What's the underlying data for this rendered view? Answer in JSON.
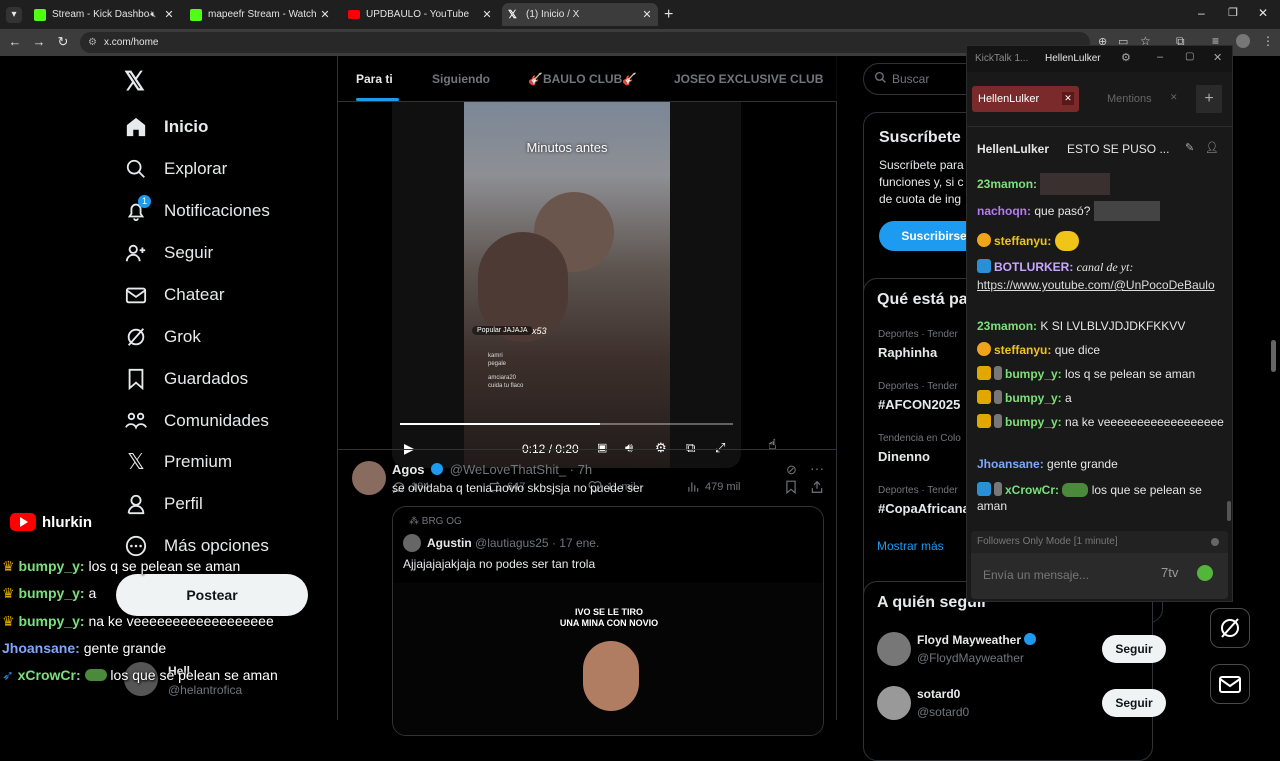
{
  "browser": {
    "tabs": [
      {
        "title": "Stream - Kick Dashboard",
        "favicon_color": "#53fc18",
        "extra": "mute-icon"
      },
      {
        "title": "mapeefr Stream - Watch Live o",
        "favicon_color": "#53fc18"
      },
      {
        "title": "UPDBAULO - YouTube",
        "favicon_color": "#ff0000"
      },
      {
        "title": "(1) Inicio / X",
        "favicon_color": "#ffffff"
      }
    ],
    "url": "x.com/home"
  },
  "nav": {
    "items": [
      {
        "label": "Inicio",
        "icon": "home-icon"
      },
      {
        "label": "Explorar",
        "icon": "search-icon"
      },
      {
        "label": "Notificaciones",
        "icon": "bell-icon",
        "badge": "1"
      },
      {
        "label": "Seguir",
        "icon": "follow-icon"
      },
      {
        "label": "Chatear",
        "icon": "mail-icon"
      },
      {
        "label": "Grok",
        "icon": "grok-icon"
      },
      {
        "label": "Guardados",
        "icon": "bookmark-icon"
      },
      {
        "label": "Comunidades",
        "icon": "communities-icon"
      },
      {
        "label": "Premium",
        "icon": "x-logo-icon"
      },
      {
        "label": "Perfil",
        "icon": "person-icon"
      },
      {
        "label": "Más opciones",
        "icon": "more-icon"
      }
    ],
    "post_button": "Postear",
    "account": {
      "name": "Hell",
      "handle": "@helantrofica"
    }
  },
  "timeline": {
    "tabs": [
      "Para ti",
      "Siguiendo",
      "🎸BAULO CLUB🎸",
      "JOSEO EXCLUSIVE CLUB"
    ],
    "video": {
      "caption": "Minutos antes",
      "time": "0:12 / 0:20",
      "progress": 0.6,
      "overlay_tag": "Popular JAJAJA",
      "overlay_count": "x53",
      "comments": [
        {
          "user": "kamri",
          "text": "pegale"
        },
        {
          "user": "amciara20",
          "text": "cuida tu flaco"
        }
      ]
    },
    "tweet1_actions": {
      "replies": "184",
      "reposts": "647",
      "likes": "11 mil",
      "views": "479 mil"
    },
    "tweet2": {
      "name": "Agos",
      "handle": "@WeLoveThatShit_",
      "time": "· 7h",
      "text": "se olvidaba q tenia novio skbsjsja no puede ser",
      "quote": {
        "community": "BRG OG",
        "name": "Agustin",
        "handle": "@lautiagus25",
        "time": "· 17 ene.",
        "text": "Ajjajajajakjaja no podes ser tan trola",
        "media_caption": "IVO SE LE TIRO\nUNA MINA CON NOVIO"
      }
    }
  },
  "sidebar": {
    "search_placeholder": "Buscar",
    "subscribe": {
      "title": "Suscríbete",
      "body1": "Suscríbete para",
      "body2": "funciones y, si c",
      "body3": "de cuota de ing",
      "button": "Suscribirse"
    },
    "trends": {
      "title": "Qué está pa",
      "items": [
        {
          "meta": "Deportes · Tender",
          "name": "Raphinha"
        },
        {
          "meta": "Deportes · Tender",
          "name": "#AFCON2025"
        },
        {
          "meta": "Tendencia en Colo",
          "name": "Dinenno"
        },
        {
          "meta": "Deportes · Tender",
          "name": "#CopaAfricana"
        }
      ],
      "show_more": "Mostrar más"
    },
    "who_to_follow": {
      "title": "A quién seguir",
      "items": [
        {
          "name": "Floyd Mayweather",
          "handle": "@FloydMayweather",
          "verified": true,
          "button": "Seguir"
        },
        {
          "name": "sotard0",
          "handle": "@sotard0",
          "verified": false,
          "button": "Seguir"
        }
      ]
    }
  },
  "kicktalk": {
    "app_title": "KickTalk 1...",
    "user": "HellenLulker",
    "tabs": [
      {
        "label": "HellenLulker"
      },
      {
        "label": "Mentions"
      }
    ],
    "stream_header_user": "HellenLulker",
    "stream_header_title": "ESTO SE PUSO ...",
    "messages": [
      {
        "user": "23mamon:",
        "text": "",
        "color": "#7be07b"
      },
      {
        "user": "nachoqn:",
        "text": "que pasó?",
        "color": "#b57cf0"
      },
      {
        "user": "steffanyu:",
        "text": "",
        "color": "#f0c419"
      },
      {
        "user": "BOTLURKER:",
        "text": "canal de yt:",
        "link": "https://www.youtube.com/@UnPocoDeBaulo",
        "color": "#c9a6ff"
      },
      {
        "user": "23mamon:",
        "text": "K SI LVLBLVJDJDKFKKVV",
        "color": "#7be07b"
      },
      {
        "user": "steffanyu:",
        "text": "que dice",
        "color": "#f0c419"
      },
      {
        "user": "bumpy_y:",
        "text": "los q se pelean se aman",
        "color": "#7be07b"
      },
      {
        "user": "bumpy_y:",
        "text": "a",
        "color": "#7be07b"
      },
      {
        "user": "bumpy_y:",
        "text": "na ke veeeeeeeeeeeeeeeeee",
        "color": "#7be07b"
      },
      {
        "user": "Jhoansane:",
        "text": "gente grande",
        "color": "#7fa7ff"
      },
      {
        "user": "xCrowCr:",
        "text": "los que se pelean se aman",
        "color": "#7be07b"
      }
    ],
    "followers_mode": "Followers Only Mode [1 minute]",
    "input_placeholder": "Envía un mensaje..."
  },
  "overlay": {
    "channel": "hlurkin",
    "lines": [
      {
        "user": "bumpy_y:",
        "text": "los q se pelean se aman",
        "color": "#7be07b"
      },
      {
        "user": "bumpy_y:",
        "text": "a",
        "color": "#7be07b"
      },
      {
        "user": "bumpy_y:",
        "text": "na ke veeeeeeeeeeeeeeeeee",
        "color": "#7be07b"
      },
      {
        "user": "Jhoansane:",
        "text": "gente grande",
        "color": "#7fa7ff"
      },
      {
        "user": "xCrowCr:",
        "text": "los que se pelean se aman",
        "color": "#7be07b"
      }
    ]
  }
}
